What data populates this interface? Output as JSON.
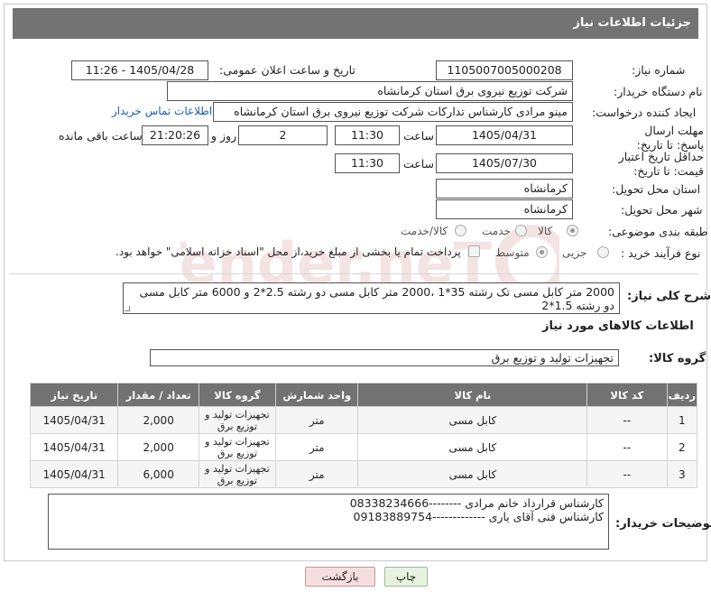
{
  "panel": {
    "title": "جزئیات اطلاعات نیاز"
  },
  "form": {
    "need_number": {
      "label": "شماره نیاز:",
      "value": "1105007005000208"
    },
    "announce_date": {
      "label": "تاریخ و ساعت اعلان عمومی:",
      "value": "1405/04/28 - 11:26"
    },
    "buyer_org": {
      "label": "نام دستگاه خریدار:",
      "value": "شرکت توزیع نیروی برق استان کرمانشاه"
    },
    "requester": {
      "label": "ایجاد کننده درخواست:",
      "value": "مینو مرادی کارشناس تدارکات شرکت توزیع نیروی برق استان کرمانشاه",
      "contact_link": "اطلاعات تماس خریدار"
    },
    "reply_deadline": {
      "label": "مهلت ارسال پاسخ: تا تاریخ:",
      "date": "1405/04/31",
      "time_label": "ساعت",
      "time": "11:30",
      "days": "2",
      "days_label": "روز و",
      "remaining": "21:20:26",
      "remaining_label": "ساعت باقی مانده"
    },
    "price_validity": {
      "label": "حداقل تاریخ اعتبار قیمت: تا تاریخ:",
      "date": "1405/07/30",
      "time_label": "ساعت",
      "time": "11:30"
    },
    "delivery_province": {
      "label": "استان محل تحویل:",
      "value": "کرمانشاه"
    },
    "delivery_city": {
      "label": "شهر محل تحویل:",
      "value": "کرمانشاه"
    },
    "category": {
      "label": "طبقه بندی موضوعی:",
      "options": [
        "کالا",
        "خدمت",
        "کالا/خدمت"
      ],
      "selected": "کالا"
    },
    "process_type": {
      "label": "نوع فرآیند خرید :",
      "options": [
        "جزیی",
        "متوسط"
      ],
      "selected": "متوسط",
      "payment_note": "پرداخت تمام یا بخشی از مبلغ خرید،از محل \"اسناد خزانه اسلامی\" خواهد بود."
    }
  },
  "description": {
    "label": "شرح کلی نیاز:",
    "text": "2000 متر کابل مسی تک رشته 35*1 ،2000 متر کابل مسی دو رشته 2.5*2 و 6000 متر کابل مسی دو رشته 1.5*2"
  },
  "goods": {
    "section_title": "اطلاعات کالاهای مورد نیاز",
    "group_label": "گروه کالا:",
    "group_value": "تجهیزات تولید و توزیع برق",
    "columns": [
      "ردیف",
      "کد کالا",
      "نام کالا",
      "واحد شمارش",
      "گروه کالا",
      "تعداد / مقدار",
      "تاریخ نیاز"
    ],
    "rows": [
      {
        "row": "1",
        "code": "--",
        "name": "کابل مسی",
        "unit": "متر",
        "group": "تجهیزات تولید و توزیع برق",
        "qty": "2,000",
        "date": "1405/04/31"
      },
      {
        "row": "2",
        "code": "--",
        "name": "کابل مسی",
        "unit": "متر",
        "group": "تجهیزات تولید و توزیع برق",
        "qty": "2,000",
        "date": "1405/04/31"
      },
      {
        "row": "3",
        "code": "--",
        "name": "کابل مسی",
        "unit": "متر",
        "group": "تجهیزات تولید و توزیع برق",
        "qty": "6,000",
        "date": "1405/04/31"
      }
    ]
  },
  "buyer_notes": {
    "label": "توضیحات خریدار:",
    "line1": "کارشناس قرارداد  خانم مرادی --------08338234666",
    "line2": "کارشناس فنی آقای یاری -------------09183889754"
  },
  "buttons": {
    "print": "چاپ",
    "back": "بازگشت"
  },
  "watermark": {
    "text": "AriaTender.neT",
    "color": "#b03030"
  }
}
